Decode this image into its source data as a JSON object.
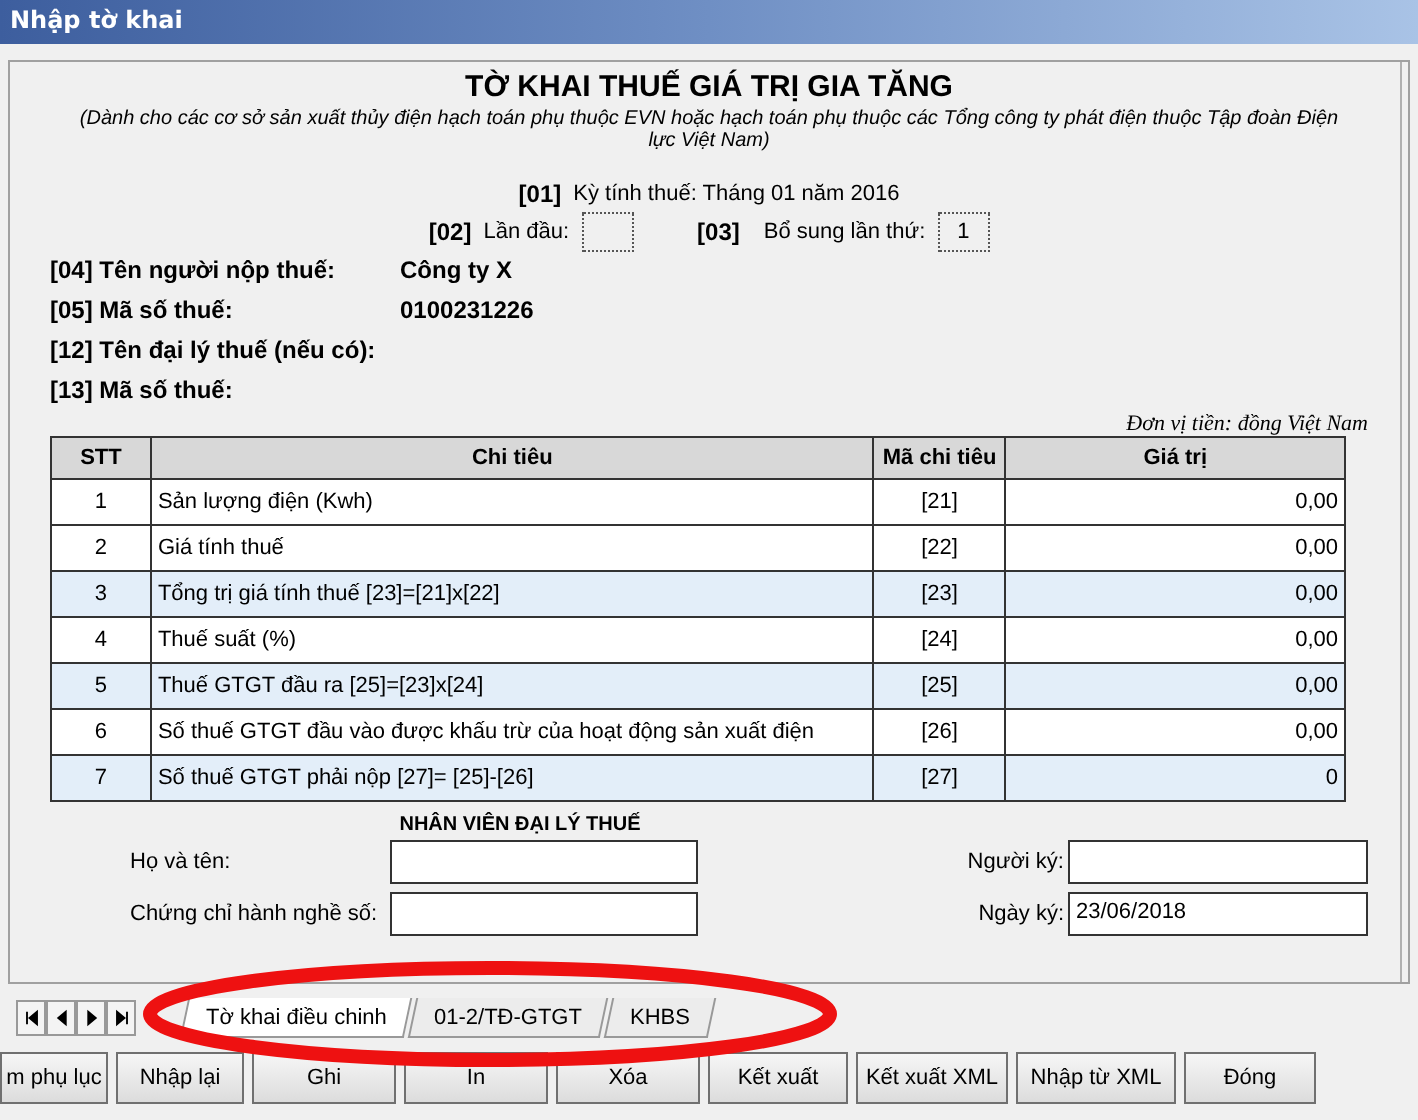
{
  "window": {
    "title": "Nhập tờ khai"
  },
  "form": {
    "title": "TỜ KHAI THUẾ GIÁ TRỊ GIA TĂNG",
    "subtitle": "(Dành cho các cơ sở sản xuất thủy điện hạch toán phụ thuộc EVN hoặc hạch toán phụ thuộc các Tổng công ty phát điện thuộc Tập đoàn Điện lực Việt Nam)",
    "period": {
      "code": "[01]",
      "text": "Kỳ tính thuế: Tháng 01 năm 2016"
    },
    "first_time": {
      "code": "[02]",
      "label": "Lần đầu:"
    },
    "supplement": {
      "code": "[03]",
      "label": "Bổ sung lần thứ:",
      "value": "1"
    },
    "info": [
      {
        "label": "[04] Tên người nộp thuế:",
        "value": "Công ty X"
      },
      {
        "label": "[05] Mã số thuế:",
        "value": "0100231226"
      },
      {
        "label": "[12] Tên đại lý thuế (nếu có):"
      },
      {
        "label": "[13] Mã số thuế:"
      }
    ],
    "currency_note": "Đơn vị tiền: đồng Việt Nam"
  },
  "table": {
    "columns": [
      "STT",
      "Chi tiêu",
      "Mã chi tiêu",
      "Giá trị"
    ],
    "rows": [
      {
        "no": "1",
        "item": "Sản lượng điện (Kwh)",
        "code": "[21]",
        "value": "0,00",
        "highlighted": false
      },
      {
        "no": "2",
        "item": "Giá tính thuế",
        "code": "[22]",
        "value": "0,00",
        "highlighted": false
      },
      {
        "no": "3",
        "item": "Tổng trị giá tính thuế [23]=[21]x[22]",
        "code": "[23]",
        "value": "0,00",
        "highlighted": true
      },
      {
        "no": "4",
        "item": "Thuế suất (%)",
        "code": "[24]",
        "value": "0,00",
        "highlighted": false
      },
      {
        "no": "5",
        "item": "Thuế GTGT đầu ra [25]=[23]x[24]",
        "code": "[25]",
        "value": "0,00",
        "highlighted": true
      },
      {
        "no": "6",
        "item": "Số thuế GTGT đầu vào được khấu trừ của hoạt động sản xuất điện",
        "code": "[26]",
        "value": "0,00",
        "highlighted": false
      },
      {
        "no": "7",
        "item": "Số thuế GTGT phải nộp [27]= [25]-[26]",
        "code": "[27]",
        "value": "0",
        "highlighted": true
      }
    ]
  },
  "agent": {
    "title": "NHÂN VIÊN ĐẠI LÝ THUẾ",
    "name_label": "Họ và tên:",
    "cert_label": "Chứng chỉ hành nghề số:",
    "signer_label": "Người ký:",
    "date_label": "Ngày ký:",
    "date_value": "23/06/2018"
  },
  "sheet_tabs": [
    {
      "label": "Tờ khai điều chinh",
      "selected": true
    },
    {
      "label": "01-2/TĐ-GTGT",
      "selected": false
    },
    {
      "label": "KHBS",
      "selected": false
    }
  ],
  "buttons": [
    "m phụ lục",
    "Nhập lại",
    "Ghi",
    "In",
    "Xóa",
    "Kết xuất",
    "Kết xuất XML",
    "Nhập từ XML",
    "Đóng"
  ]
}
